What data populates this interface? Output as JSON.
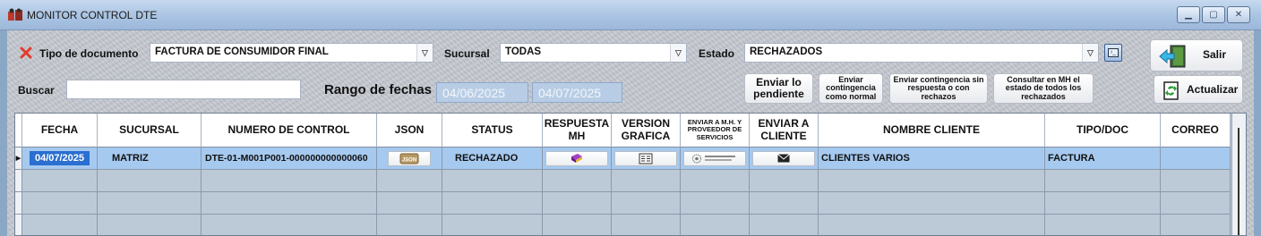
{
  "window": {
    "title": "MONITOR CONTROL DTE",
    "buttons": [
      "minimize",
      "maximize",
      "close"
    ]
  },
  "filters": {
    "tipo_label": "Tipo de documento",
    "tipo_value": "FACTURA DE CONSUMIDOR FINAL",
    "sucursal_label": "Sucursal",
    "sucursal_value": "TODAS",
    "estado_label": "Estado",
    "estado_value": "RECHAZADOS",
    "buscar_label": "Buscar",
    "buscar_value": "",
    "rango_label": "Rango de fechas",
    "fecha_desde": "04/06/2025",
    "fecha_hasta": "04/07/2025"
  },
  "actions": {
    "salir": "Salir",
    "actualizar": "Actualizar",
    "enviar_pendiente": "Enviar lo pendiente",
    "enviar_contingencia_normal": "Enviar contingencia como normal",
    "enviar_contingencia_sin_respuesta": "Enviar contingencia sin respuesta o con rechazos",
    "consultar_mh": "Consultar en MH el estado de todos los rechazados"
  },
  "grid": {
    "columns": [
      "FECHA",
      "SUCURSAL",
      "NUMERO DE CONTROL",
      "JSON",
      "STATUS",
      "RESPUESTA MH",
      "VERSION GRAFICA",
      "ENVIAR A M.H. Y PROVEEDOR DE SERVICIOS",
      "ENVIAR A CLIENTE",
      "NOMBRE CLIENTE",
      "TIPO/DOC",
      "CORREO"
    ],
    "rows": [
      {
        "fecha": "04/07/2025",
        "sucursal": "MATRIZ",
        "numero_control": "DTE-01-M001P001-000000000000060",
        "json_icon": "json-file-icon",
        "status": "RECHAZADO",
        "respuesta_icon": "book-icon",
        "version_icon": "document-list-icon",
        "enviar_mh_icon": "ministerio-hacienda-logo",
        "enviar_cliente_icon": "envelope-icon",
        "nombre_cliente": "CLIENTES VARIOS",
        "tipo_doc": "FACTURA",
        "correo": ""
      }
    ]
  },
  "colors": {
    "selected_row": "#a6c9ef",
    "close_x": "#e23b2e",
    "exit_arrow": "#38b8e8"
  }
}
